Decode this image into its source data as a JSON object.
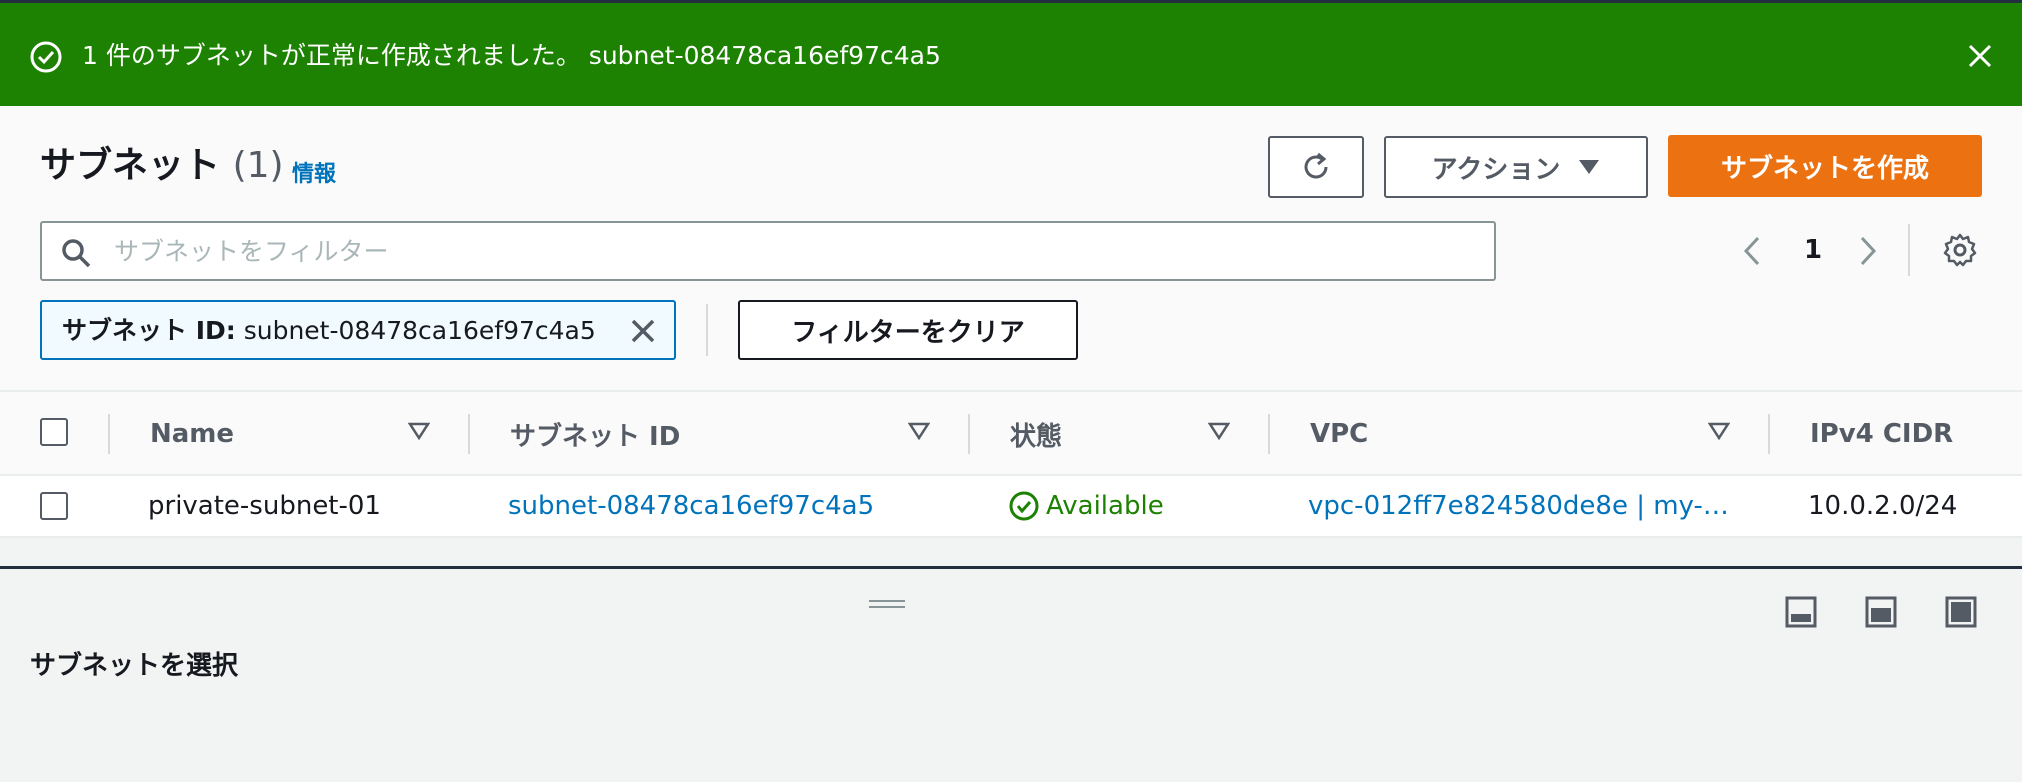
{
  "flash": {
    "message": "1 件のサブネットが正常に作成されました。 subnet-08478ca16ef97c4a5",
    "icon": "check-circle-icon",
    "close_icon": "close-icon",
    "color": "#1d8102"
  },
  "header": {
    "title": "サブネット",
    "count": "(1)",
    "info_link": "情報",
    "refresh_icon": "refresh-icon",
    "actions_label": "アクション",
    "create_label": "サブネットを作成",
    "primary_color": "#ec7211"
  },
  "search": {
    "placeholder": "サブネットをフィルター",
    "value": ""
  },
  "pagination": {
    "current_page": "1"
  },
  "filter": {
    "token_key": "サブネット ID:",
    "token_value": "subnet-08478ca16ef97c4a5",
    "clear_label": "フィルターをクリア"
  },
  "table": {
    "columns": [
      "Name",
      "サブネット ID",
      "状態",
      "VPC",
      "IPv4 CIDR"
    ],
    "rows": [
      {
        "name": "private-subnet-01",
        "subnet_id": "subnet-08478ca16ef97c4a5",
        "state": "Available",
        "vpc": "vpc-012ff7e824580de8e | my-…",
        "cidr": "10.0.2.0/24"
      }
    ]
  },
  "split_panel": {
    "title": "サブネットを選択"
  }
}
